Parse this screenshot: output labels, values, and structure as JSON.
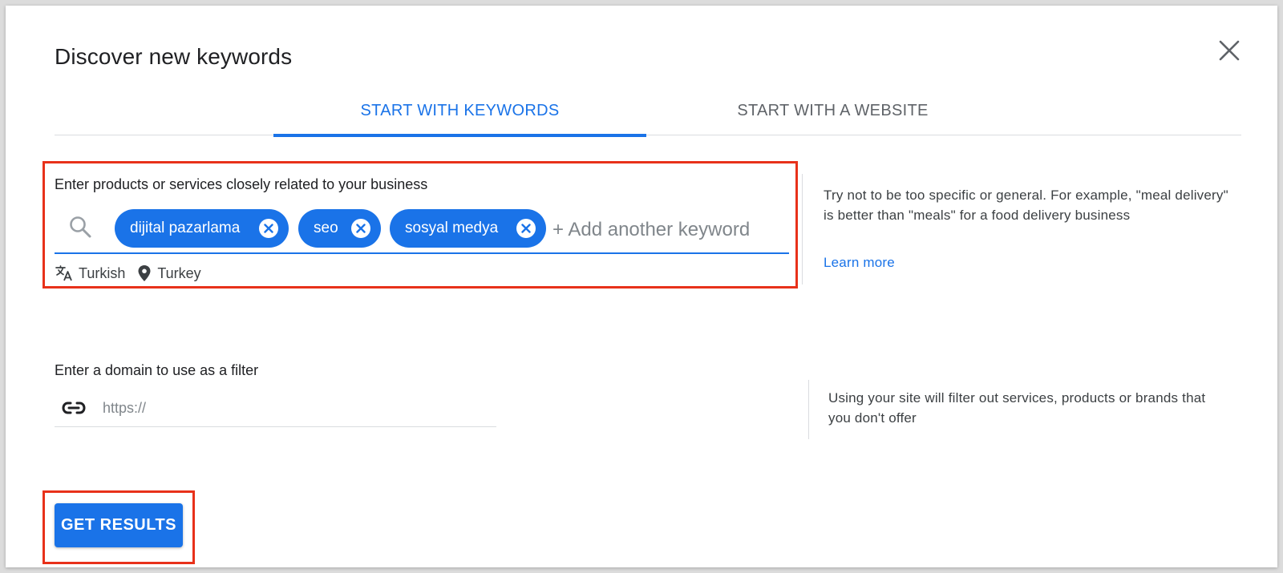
{
  "dialog": {
    "title": "Discover new keywords",
    "close_icon": "close-icon"
  },
  "tabs": [
    {
      "label": "START WITH KEYWORDS",
      "active": true
    },
    {
      "label": "START WITH A WEBSITE",
      "active": false
    }
  ],
  "keywords_section": {
    "label": "Enter products or services closely related to your business",
    "search_icon": "search-icon",
    "chips": [
      "dijital pazarlama",
      "seo",
      "sosyal medya"
    ],
    "chip_remove_icon": "close-circle-icon",
    "add_placeholder": "+ Add another keyword",
    "language": "Turkish",
    "language_icon": "translate-icon",
    "location": "Turkey",
    "location_icon": "location-pin-icon",
    "hint": "Try not to be too specific or general. For example, \"meal delivery\" is better than \"meals\" for a food delivery business",
    "learn_more": "Learn more"
  },
  "domain_section": {
    "label": "Enter a domain to use as a filter",
    "link_icon": "link-icon",
    "placeholder": "https://",
    "value": "",
    "hint": "Using your site will filter out services, products or brands that you don't offer"
  },
  "actions": {
    "get_results": "GET RESULTS"
  },
  "colors": {
    "accent": "#1a73e8",
    "highlight": "#e8311a",
    "text": "#202124",
    "muted": "#5f6368"
  }
}
